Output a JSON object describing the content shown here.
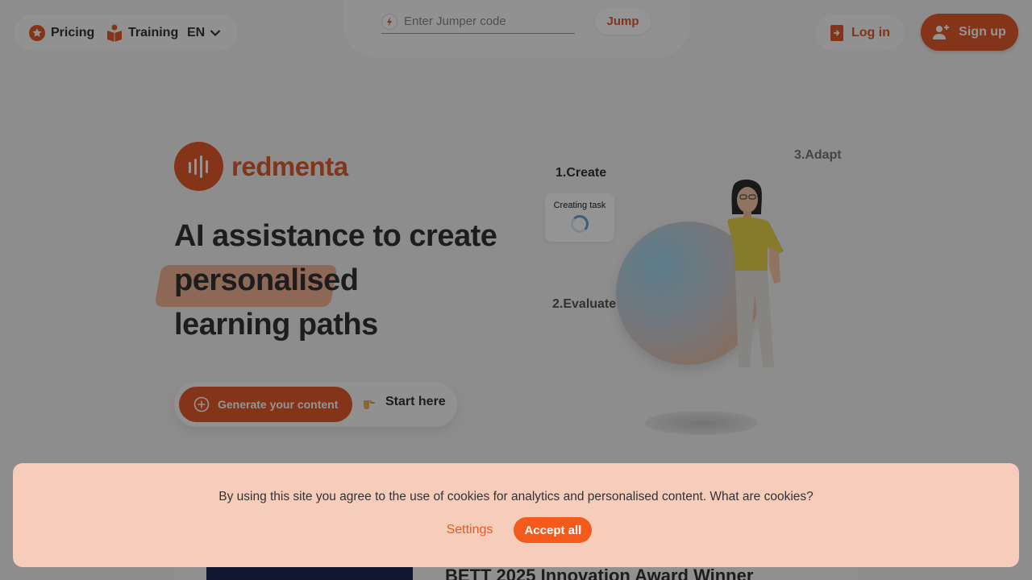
{
  "nav": {
    "pricing": "Pricing",
    "training": "Training",
    "language": "EN"
  },
  "jumper": {
    "placeholder": "Enter Jumper code",
    "button": "Jump"
  },
  "auth": {
    "login": "Log in",
    "signup": "Sign up"
  },
  "brand": {
    "name": "redmenta",
    "color": "#e35a2a"
  },
  "hero": {
    "line1": "AI assistance to create",
    "highlight": "personalised",
    "line3": "learning paths"
  },
  "cta": {
    "generate": "Generate your content",
    "start": "Start here"
  },
  "steps": {
    "create": "1.Create",
    "evaluate": "2.Evaluate",
    "adapt": "3.Adapt",
    "task_status": "Creating task"
  },
  "award": {
    "title": "BETT 2025 Innovation Award Winner"
  },
  "cookie": {
    "message": "By using this site you agree to the use of cookies for analytics and personalised content. What are cookies?",
    "settings": "Settings",
    "accept": "Accept all",
    "accent": "#f45a1b"
  },
  "icons": [
    "star-icon",
    "book-icon",
    "chevron-down-icon",
    "bolt-icon",
    "login-icon",
    "add-user-icon",
    "plus-circle-icon",
    "pointing-hand-icon",
    "spinner-icon"
  ]
}
